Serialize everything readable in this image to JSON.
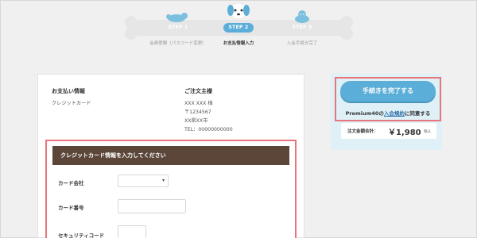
{
  "stepper": {
    "steps": [
      {
        "label": "STEP 1",
        "caption": "会員登録（パスワード変更）",
        "state": "done"
      },
      {
        "label": "STEP 2",
        "caption": "お支払情報入力",
        "state": "current"
      },
      {
        "label": "STEP 3",
        "caption": "入会手続き完了",
        "state": "upcoming"
      }
    ]
  },
  "payment_info": {
    "title": "お支払い情報",
    "method": "クレジットカード"
  },
  "orderer": {
    "title": "ご注文主様",
    "name": "XXX XXX 様",
    "postal": "〒1234567",
    "address": "XX県XX市",
    "tel": "TEL：00000000000"
  },
  "credit_card": {
    "header": "クレジットカード情報を入力してください",
    "company_label": "カード会社",
    "company_selected": "",
    "number_label": "カード番号",
    "number_value": "",
    "security_label": "セキュリティコード",
    "security_value": ""
  },
  "sidebar": {
    "complete_button": "手続きを完了する",
    "agree_prefix": "Premium40の",
    "agree_link": "入会規約",
    "agree_suffix": "に同意する",
    "total_label": "注文金額合計：",
    "total_value": "￥1,980",
    "total_tax": "税込"
  },
  "colors": {
    "accent_blue": "#5aaed8",
    "highlight_red": "#e9747c",
    "header_brown": "#5b4639",
    "side_panel": "#dff0f7"
  }
}
